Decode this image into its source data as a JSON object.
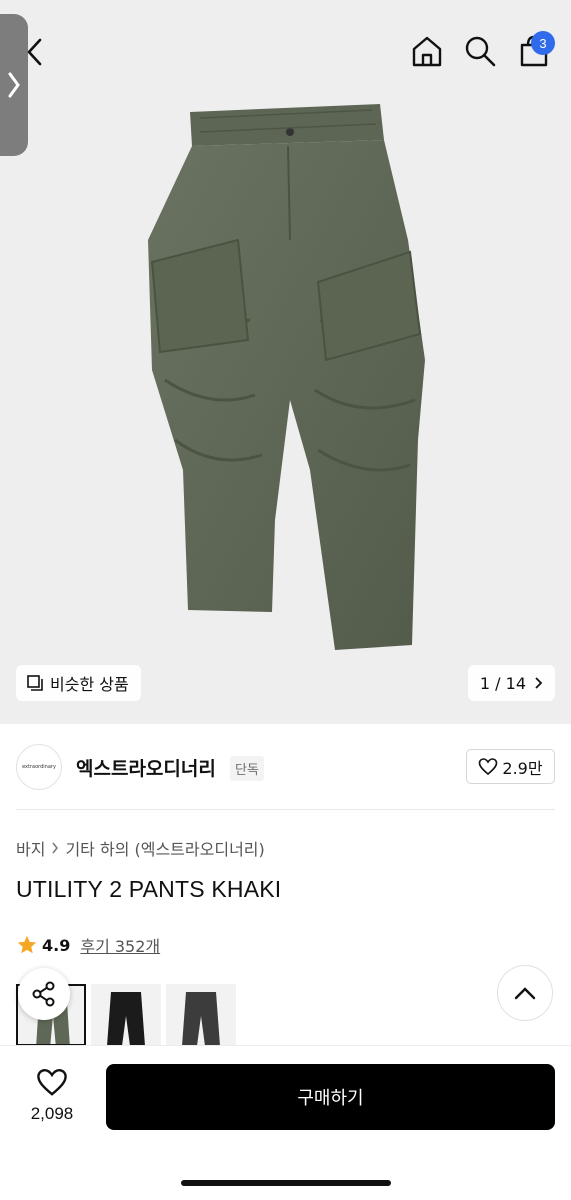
{
  "header": {
    "cart_count": "3",
    "icons": [
      "back-icon",
      "home-icon",
      "search-icon",
      "shopping-bag-icon"
    ]
  },
  "gallery": {
    "similar_label": "비슷한 상품",
    "page_indicator": "1 / 14",
    "next_icon": "chevron-right-icon"
  },
  "brand": {
    "logo_text": "extraordinary",
    "name": "엑스트라오디너리",
    "tag": "단독",
    "likes": "2.9만"
  },
  "breadcrumb": {
    "category": "바지",
    "subcategory": "기타 하의 (엑스트라오디너리)"
  },
  "product": {
    "title": "UTILITY 2 PANTS KHAKI",
    "rating": "4.9",
    "reviews": "후기 352개"
  },
  "colors": {
    "accent_badge": "#2f6bea",
    "star": "#f5a623",
    "buy_button": "#000000",
    "pants_khaki": "#5f6857"
  },
  "bottom_bar": {
    "wish_count": "2,098",
    "buy_label": "구매하기"
  }
}
